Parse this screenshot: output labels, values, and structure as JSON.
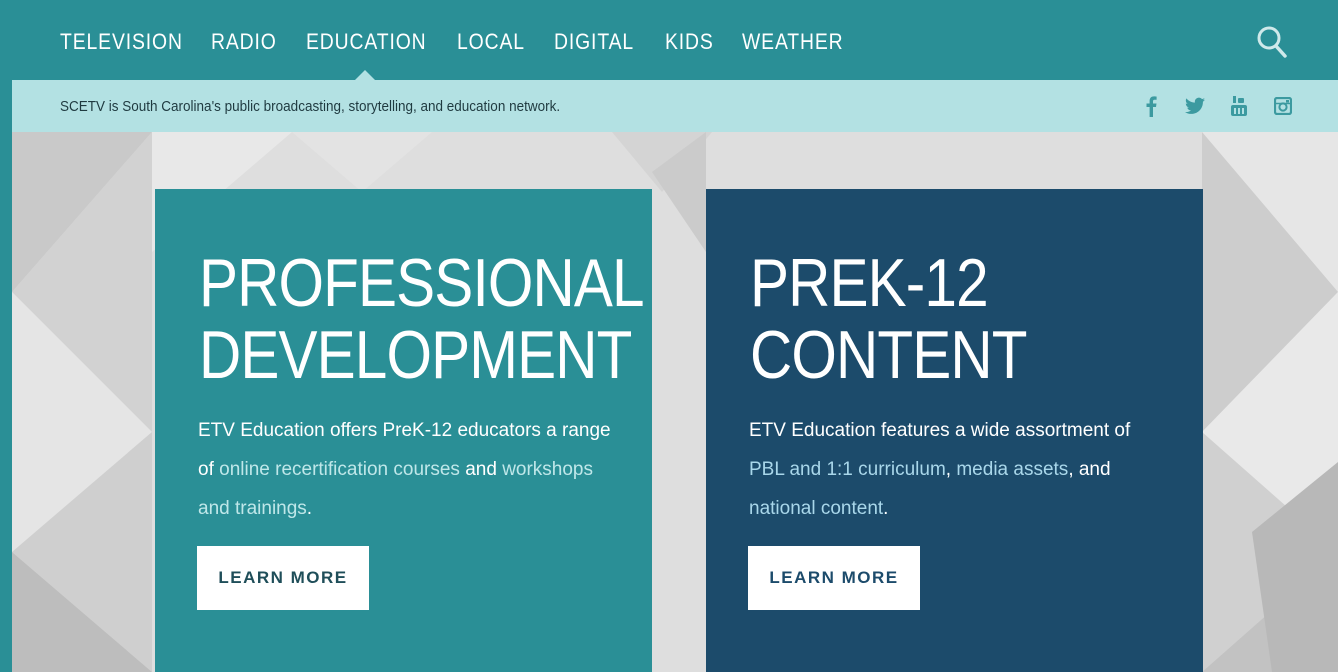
{
  "nav": {
    "items": [
      {
        "label": "TELEVISION"
      },
      {
        "label": "RADIO"
      },
      {
        "label": "EDUCATION"
      },
      {
        "label": "LOCAL"
      },
      {
        "label": "DIGITAL"
      },
      {
        "label": "KIDS"
      },
      {
        "label": "WEATHER"
      }
    ],
    "active": "EDUCATION",
    "search_icon": "search-icon"
  },
  "tagbar": {
    "text": "SCETV is South Carolina's public broadcasting, storytelling, and education network.",
    "social": [
      "facebook-icon",
      "twitter-icon",
      "youtube-icon",
      "instagram-icon"
    ]
  },
  "cards": [
    {
      "title_line1": "PROFESSIONAL",
      "title_line2": "DEVELOPMENT",
      "text_1": "ETV Education offers PreK-12 educators a range of ",
      "link_1": "online recertification courses",
      "text_2": " and ",
      "link_2": "workshops and trainings",
      "text_3": ".",
      "button": "LEARN MORE"
    },
    {
      "title_line1": "PREK-12",
      "title_line2": "CONTENT",
      "text_1": "ETV Education features a wide assortment of ",
      "link_1": "PBL and 1:1 curriculum",
      "text_2": ", ",
      "link_2": "media assets",
      "text_3": ", and ",
      "link_3": "national content",
      "text_4": ".",
      "button": "LEARN MORE"
    }
  ],
  "colors": {
    "nav_bg": "#2a8f96",
    "tagbar_bg": "#b3e1e3",
    "card_pd": "#2a8f96",
    "card_prek": "#1c4b6b"
  }
}
